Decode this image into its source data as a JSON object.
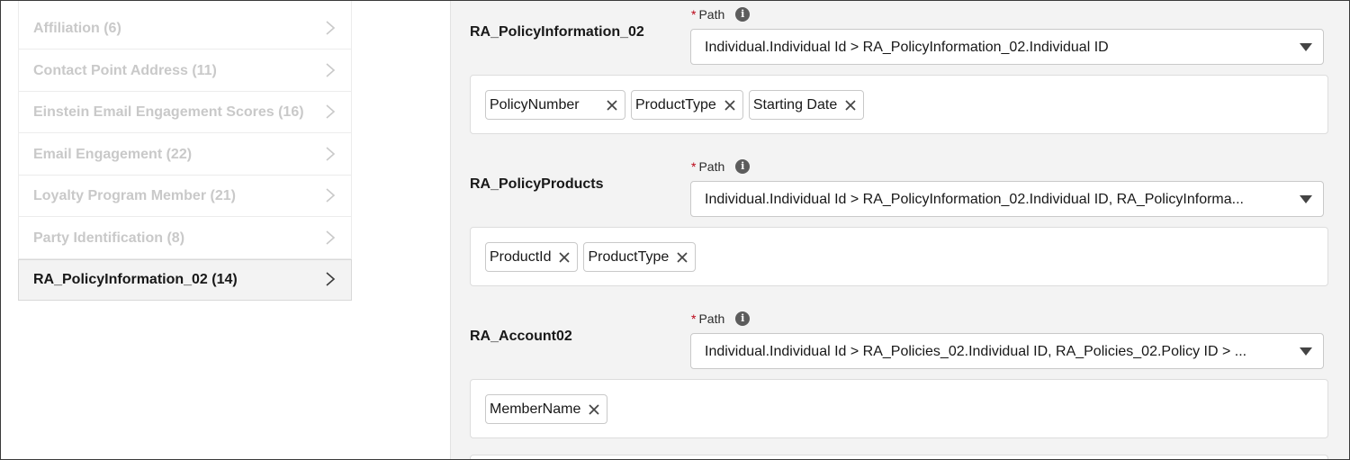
{
  "sidebar": {
    "items": [
      {
        "label": "Affiliation (6)"
      },
      {
        "label": "Contact Point Address (11)"
      },
      {
        "label": "Einstein Email Engagement Scores (16)"
      },
      {
        "label": "Email Engagement (22)"
      },
      {
        "label": "Loyalty Program Member (21)"
      },
      {
        "label": "Party Identification (8)"
      },
      {
        "label": "RA_PolicyInformation_02 (14)"
      }
    ]
  },
  "main": {
    "path_required_mark": "*",
    "path_label": "Path",
    "info_glyph": "i",
    "sections": [
      {
        "title": "RA_PolicyInformation_02",
        "path_value": "Individual.Individual Id > RA_PolicyInformation_02.Individual ID",
        "fields": [
          "PolicyNumber",
          "ProductType",
          "Starting Date"
        ]
      },
      {
        "title": "RA_PolicyProducts",
        "path_value": "Individual.Individual Id > RA_PolicyInformation_02.Individual ID, RA_PolicyInforma...",
        "fields": [
          "ProductId",
          "ProductType"
        ]
      },
      {
        "title": "RA_Account02",
        "path_value": "Individual.Individual Id > RA_Policies_02.Individual ID, RA_Policies_02.Policy ID > ...",
        "fields": [
          "MemberName"
        ]
      }
    ]
  },
  "icons": {
    "chevron": "chevron-right-icon",
    "info": "info-icon",
    "caret": "caret-down-icon",
    "remove": "close-icon"
  },
  "colors": {
    "required": "#ba0517",
    "panel_bg": "#f3f3f3",
    "inactive_text": "#c9c9c9"
  }
}
